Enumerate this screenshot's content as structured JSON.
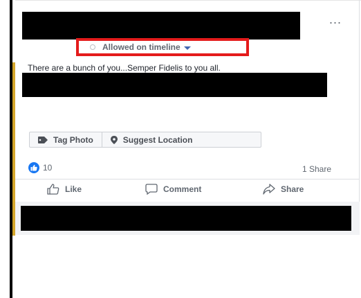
{
  "post": {
    "audience_label": "Allowed on timeline",
    "text": "There are a bunch of you...Semper Fidelis to you all.",
    "more_label": "..."
  },
  "media_actions": {
    "tag_photo": "Tag Photo",
    "suggest_location": "Suggest Location"
  },
  "stats": {
    "like_count": "10",
    "share_count": "1 Share"
  },
  "actions": {
    "like": "Like",
    "comment": "Comment",
    "share": "Share"
  },
  "colors": {
    "highlight_box": "#e41b1b",
    "accent_bar": "#d4a62a",
    "like_blue": "#1877f2"
  },
  "icons": [
    "more-options-icon",
    "audience-dot-icon",
    "caret-down-icon",
    "tag-icon",
    "location-pin-icon",
    "like-badge-icon",
    "thumbs-up-icon",
    "comment-icon",
    "share-arrow-icon"
  ]
}
